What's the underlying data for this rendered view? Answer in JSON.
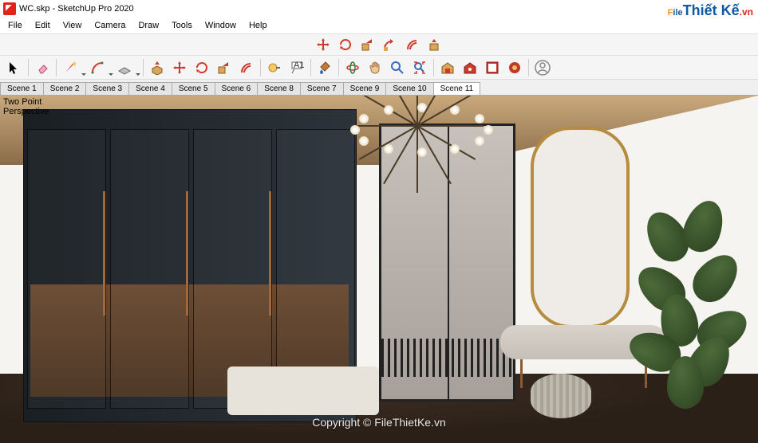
{
  "window": {
    "title": "WC.skp - SketchUp Pro 2020"
  },
  "menu": [
    "File",
    "Edit",
    "View",
    "Camera",
    "Draw",
    "Tools",
    "Window",
    "Help"
  ],
  "top_tools": [
    "move",
    "rotate",
    "scale",
    "followme",
    "offset",
    "pushpull"
  ],
  "tools": [
    {
      "name": "select",
      "type": "arrow"
    },
    {
      "name": "eraser",
      "type": "eraser"
    },
    {
      "name": "line",
      "type": "pencil",
      "flyout": true
    },
    {
      "name": "arc",
      "type": "arc",
      "flyout": true
    },
    {
      "name": "shape",
      "type": "rect",
      "flyout": true
    },
    {
      "name": "pushpull",
      "type": "pushpull"
    },
    {
      "name": "move",
      "type": "move"
    },
    {
      "name": "rotate",
      "type": "rotate"
    },
    {
      "name": "scale",
      "type": "scale"
    },
    {
      "name": "offset",
      "type": "offset"
    },
    {
      "name": "tape",
      "type": "tape"
    },
    {
      "name": "text",
      "type": "text"
    },
    {
      "name": "paint",
      "type": "paint"
    },
    {
      "name": "orbit",
      "type": "orbit"
    },
    {
      "name": "pan",
      "type": "pan"
    },
    {
      "name": "zoom",
      "type": "zoom"
    },
    {
      "name": "zoom-extents",
      "type": "zoom-extents"
    },
    {
      "name": "warehouse",
      "type": "warehouse"
    },
    {
      "name": "ext-warehouse",
      "type": "ext-warehouse"
    },
    {
      "name": "layout",
      "type": "layout"
    },
    {
      "name": "engine",
      "type": "engine"
    },
    {
      "name": "user",
      "type": "user"
    }
  ],
  "scenes": {
    "items": [
      "Scene 1",
      "Scene 2",
      "Scene 3",
      "Scene 4",
      "Scene 5",
      "Scene 6",
      "Scene 8",
      "Scene 7",
      "Scene 9",
      "Scene 10",
      "Scene 11"
    ],
    "active": 10
  },
  "viewport": {
    "overlay_line1": "Two Point",
    "overlay_line2": "Perspective"
  },
  "watermark": {
    "logo_p1": "F",
    "logo_p2": "ile",
    "logo_p3": "Thiết Kế",
    "logo_suffix": ".vn",
    "center": "Copyright © FileThietKe.vn"
  }
}
